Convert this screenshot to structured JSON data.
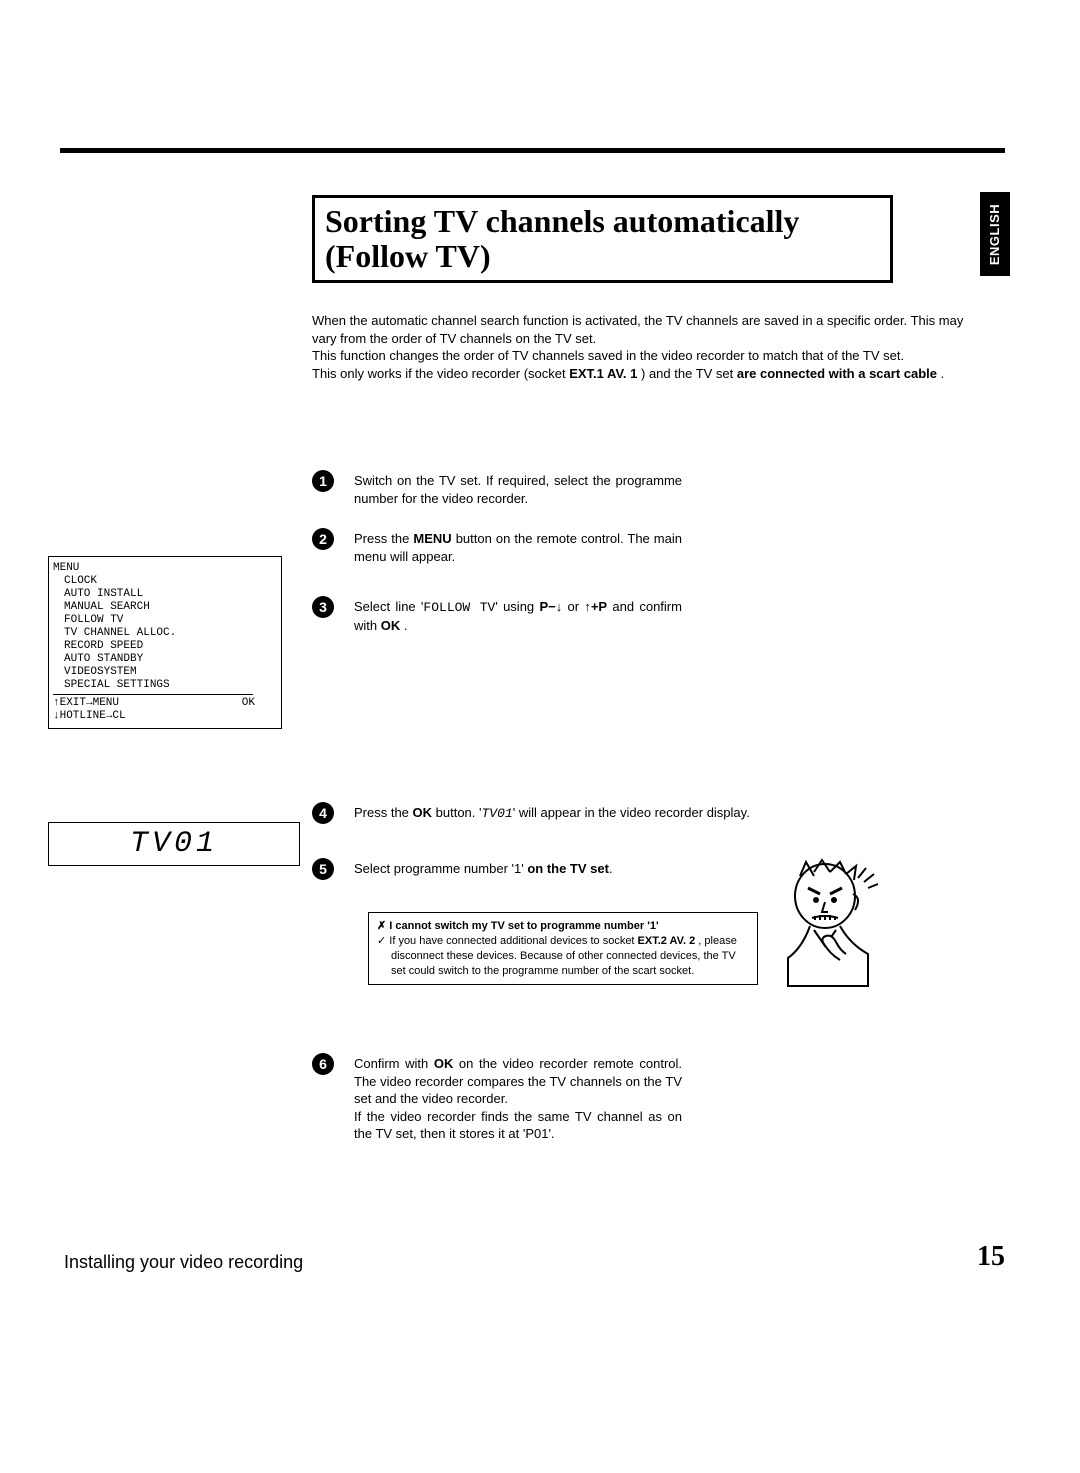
{
  "language_tab": "ENGLISH",
  "title": "Sorting TV channels automatically (Follow TV)",
  "intro": {
    "p1": "When the automatic channel search function is activated, the TV channels are saved in a specific order. This may vary from the order of TV channels on the TV set.",
    "p2": "This function changes the order of TV channels saved in the video recorder to match that of the TV set.",
    "p3a": "This only works if the video recorder (socket ",
    "p3_socket": "EXT.1 AV. 1",
    "p3b": " ) and the TV set ",
    "p3_bold": "are connected with a scart cable",
    "p3c": " ."
  },
  "steps": {
    "s1": "Switch on the TV set. If required, select the programme number for the video recorder.",
    "s2a": "Press the ",
    "s2_btn": "MENU",
    "s2b": " button on the remote control. The main menu will appear.",
    "s3a": "Select line '",
    "s3_follow": "FOLLOW TV",
    "s3b": "' using ",
    "s3_p1": "P",
    "s3_minus": "−",
    "s3_down": "↓",
    "s3_or": " or ",
    "s3_up": "↑",
    "s3_plus": "+",
    "s3_p2": "P",
    "s3c": " and confirm with ",
    "s3_ok": "OK",
    "s3d": " .",
    "s4a": "Press the ",
    "s4_ok": "OK",
    "s4b": " button. '",
    "s4_disp": "TV01",
    "s4c": "' will appear in the video recorder display.",
    "s5a": "Select programme number '1' ",
    "s5_bold": "on the TV set",
    "s5b": ".",
    "s6a": "Confirm with ",
    "s6_ok": "OK",
    "s6b": " on the video recorder remote control. The video recorder compares the TV channels on the TV set and the video recorder.",
    "s6c": "If the video recorder finds the same TV channel as on the TV set, then it stores it at 'P01'."
  },
  "menu": {
    "title": "MENU",
    "items": [
      "CLOCK",
      "AUTO INSTALL",
      "MANUAL SEARCH",
      "FOLLOW TV",
      "TV CHANNEL ALLOC.",
      "RECORD SPEED",
      "AUTO STANDBY",
      "VIDEOSYSTEM",
      "SPECIAL SETTINGS"
    ],
    "footer1_left": "↑EXIT→MENU",
    "footer1_right": "OK",
    "footer2": "↓HOTLINE→CL"
  },
  "display": "TV01",
  "note": {
    "x": "✗",
    "title": "I cannot switch my TV set to programme number '1'",
    "check": "✓",
    "body_a": " If you have connected additional devices to socket ",
    "body_socket": "EXT.2 AV. 2",
    "body_b": " , please disconnect these devices. Because of other connected devices, the TV set could switch to the programme number of the scart socket."
  },
  "footer": {
    "left": "Installing your video recording",
    "page": "15"
  }
}
